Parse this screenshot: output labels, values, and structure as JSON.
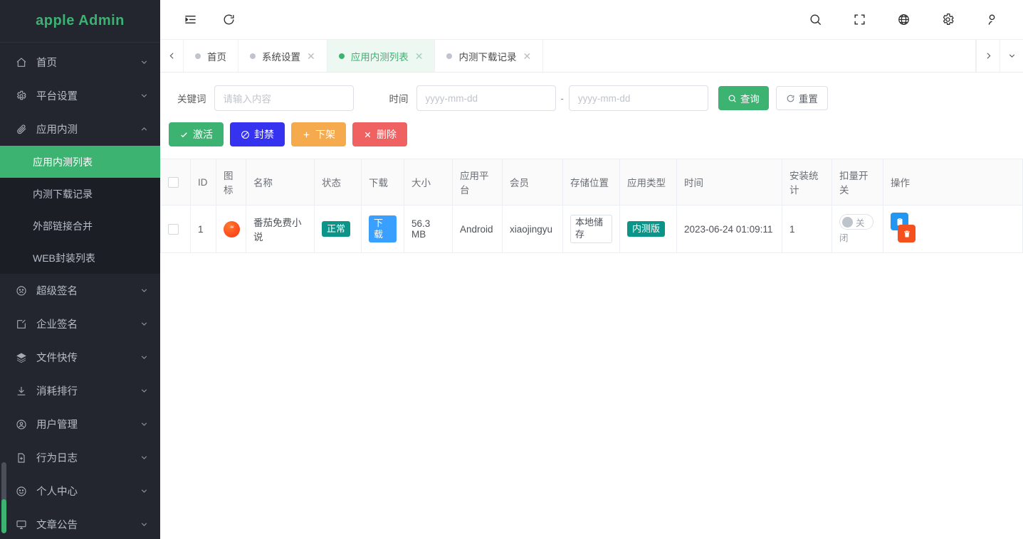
{
  "sidebar": {
    "brand": "apple Admin",
    "items": [
      {
        "icon": "home-icon",
        "label": "首页",
        "expandable": true,
        "expanded": false
      },
      {
        "icon": "gear-icon",
        "label": "平台设置",
        "expandable": true,
        "expanded": false
      },
      {
        "icon": "paperclip-icon",
        "label": "应用内测",
        "expandable": true,
        "expanded": true,
        "children": [
          {
            "label": "应用内测列表",
            "active": true
          },
          {
            "label": "内测下载记录",
            "active": false
          },
          {
            "label": "外部链接合并",
            "active": false
          },
          {
            "label": "WEB封装列表",
            "active": false
          }
        ]
      },
      {
        "icon": "face-icon",
        "label": "超级签名",
        "expandable": true,
        "expanded": false
      },
      {
        "icon": "edit-square-icon",
        "label": "企业签名",
        "expandable": true,
        "expanded": false
      },
      {
        "icon": "layers-icon",
        "label": "文件快传",
        "expandable": true,
        "expanded": false
      },
      {
        "icon": "download-icon",
        "label": "消耗排行",
        "expandable": true,
        "expanded": false
      },
      {
        "icon": "user-circle-icon",
        "label": "用户管理",
        "expandable": true,
        "expanded": false
      },
      {
        "icon": "file-plus-icon",
        "label": "行为日志",
        "expandable": true,
        "expanded": false
      },
      {
        "icon": "smiley-icon",
        "label": "个人中心",
        "expandable": true,
        "expanded": false
      },
      {
        "icon": "monitor-icon",
        "label": "文章公告",
        "expandable": true,
        "expanded": false
      }
    ]
  },
  "topbar": {
    "left_icons": [
      "menu-fold-icon",
      "refresh-icon"
    ],
    "right_icons": [
      "search-icon",
      "fullscreen-icon",
      "globe-icon",
      "gear-icon",
      "user-icon"
    ]
  },
  "tabbar": {
    "prev_icon": "chevron-left-icon",
    "next_icon": "chevron-right-icon",
    "more_icon": "chevron-down-icon",
    "tabs": [
      {
        "label": "首页",
        "active": false,
        "closable": false
      },
      {
        "label": "系统设置",
        "active": false,
        "closable": true
      },
      {
        "label": "应用内测列表",
        "active": true,
        "closable": true
      },
      {
        "label": "内测下载记录",
        "active": false,
        "closable": true
      }
    ],
    "close_glyph": "✕"
  },
  "filter": {
    "keyword_label": "关键词",
    "keyword_placeholder": "请输入内容",
    "keyword_value": "",
    "time_label": "时间",
    "date_start_placeholder": "yyyy-mm-dd",
    "date_start_value": "",
    "date_end_placeholder": "yyyy-mm-dd",
    "date_end_value": "",
    "dash": "-",
    "search_label": "查询",
    "reset_label": "重置"
  },
  "actions": [
    {
      "label": "激活",
      "color": "#3cb371",
      "icon": "check-icon"
    },
    {
      "label": "封禁",
      "color": "#3633f0",
      "icon": "ban-icon"
    },
    {
      "label": "下架",
      "color": "#f5a council",
      "icon": "plus-icon"
    },
    {
      "label": "删除",
      "color": "#f06262",
      "icon": "close-icon"
    }
  ],
  "action_colors": {
    "activate": "#3cb371",
    "ban": "#3633f0",
    "remove": "#f5a council",
    "delete": "#f06262"
  },
  "table": {
    "columns": [
      {
        "key": "select",
        "label": ""
      },
      {
        "key": "id",
        "label": "ID"
      },
      {
        "key": "icon",
        "label": "图标"
      },
      {
        "key": "name",
        "label": "名称"
      },
      {
        "key": "status",
        "label": "状态"
      },
      {
        "key": "download",
        "label": "下载"
      },
      {
        "key": "size",
        "label": "大小"
      },
      {
        "key": "platform",
        "label": "应用平台"
      },
      {
        "key": "member",
        "label": "会员"
      },
      {
        "key": "storage",
        "label": "存储位置"
      },
      {
        "key": "app_type",
        "label": "应用类型"
      },
      {
        "key": "time",
        "label": "时间"
      },
      {
        "key": "install_stat",
        "label": "安装统计"
      },
      {
        "key": "deduct_switch",
        "label": "扣量开关"
      },
      {
        "key": "operation",
        "label": "操作"
      }
    ],
    "rows": [
      {
        "selected": false,
        "id": "1",
        "icon": "app-icon-tomato",
        "name": "番茄免费小说",
        "status": "正常",
        "status_color": "#0d9488",
        "download": "下载",
        "download_color": "#3aa0ff",
        "size": "56.3 MB",
        "platform": "Android",
        "member": "xiaojingyu",
        "storage": "本地储存",
        "app_type": "内测版",
        "app_type_color": "#0d9488",
        "time": "2023-06-24 01:09:11",
        "install_stat": "1",
        "deduct_switch": {
          "on": false,
          "label": "关闭"
        },
        "operation": [
          {
            "icon": "clipboard-icon",
            "color": "#2196f3"
          },
          {
            "icon": "trash-icon",
            "color": "#f4511e"
          }
        ]
      }
    ]
  },
  "colors": {
    "sidebar_bg": "#23262e",
    "sidebar_sub_bg": "#1b1e25",
    "brand_green": "#3bb272",
    "active_green": "#3cb371",
    "tab_active_bg": "#ecf8f1"
  }
}
